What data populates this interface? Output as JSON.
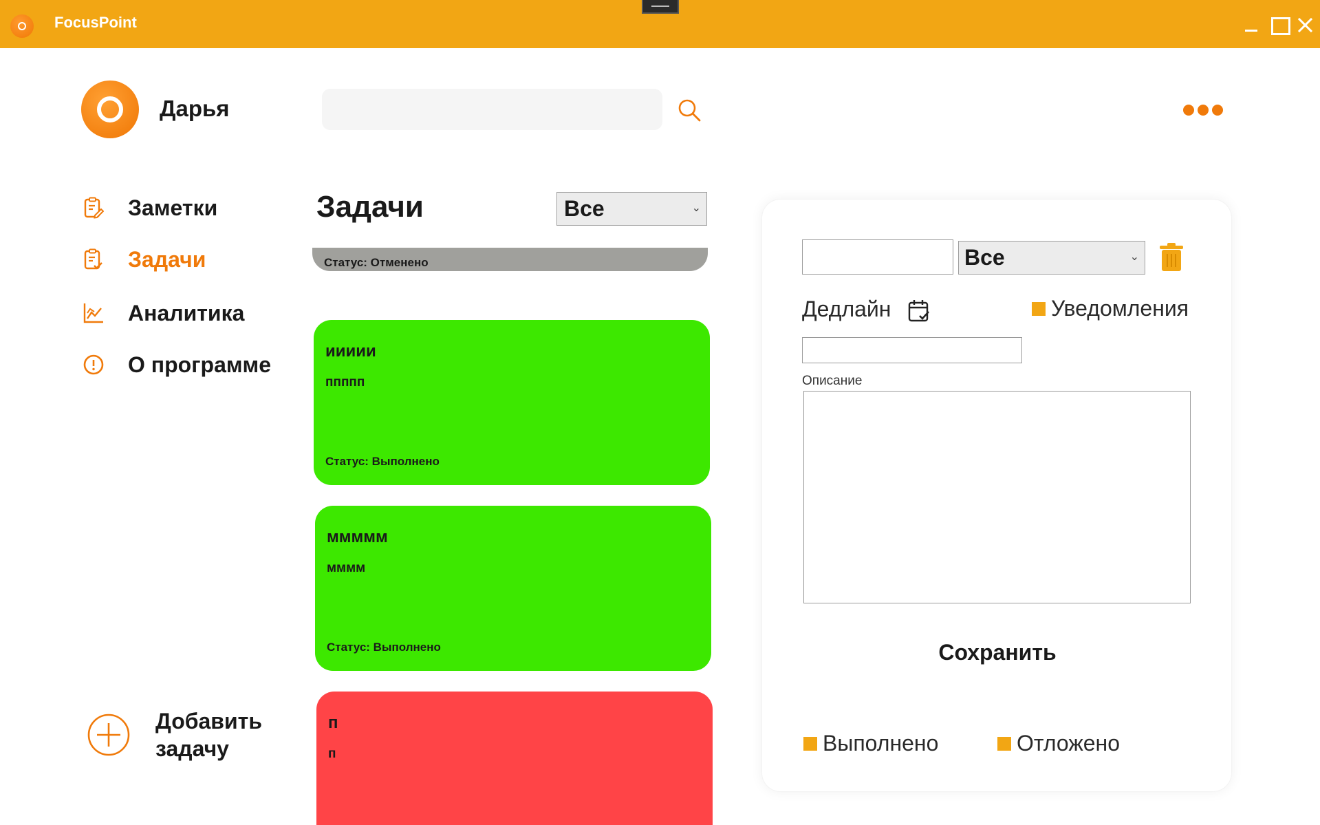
{
  "window": {
    "title": "FocusPoint"
  },
  "header": {
    "username": "Дарья",
    "search": {
      "value": "",
      "placeholder": ""
    }
  },
  "sidebar": {
    "items": [
      {
        "label": "Заметки",
        "icon": "notes-icon",
        "active": false
      },
      {
        "label": "Задачи",
        "icon": "tasks-icon",
        "active": true
      },
      {
        "label": "Аналитика",
        "icon": "analytics-icon",
        "active": false
      },
      {
        "label": "О программе",
        "icon": "info-icon",
        "active": false
      }
    ],
    "add_task_label": "Добавить задачу"
  },
  "tasks": {
    "title": "Задачи",
    "filter_value": "Все",
    "items": [
      {
        "title": "",
        "description": "",
        "status": "Статус: Отменено",
        "color": "#a0a09c"
      },
      {
        "title": "иииии",
        "description": "ппппп",
        "status": "Статус: Выполнено",
        "color": "#3de800"
      },
      {
        "title": "ммммм",
        "description": "мммм",
        "status": "Статус: Выполнено",
        "color": "#3de800"
      },
      {
        "title": "п",
        "description": "п",
        "status": "",
        "color": "#ff4447"
      }
    ]
  },
  "editor": {
    "title_value": "",
    "status_value": "Все",
    "deadline_label": "Дедлайн",
    "deadline_value": "",
    "notifications_label": "Уведомления",
    "description_label": "Описание",
    "description_value": "",
    "save_label": "Сохранить",
    "done_label": "Выполнено",
    "postponed_label": "Отложено"
  },
  "colors": {
    "accent": "#f07a0a",
    "titlebar": "#f2a614",
    "checkbox": "#f2a614",
    "done": "#3de800",
    "cancelled": "#a0a09c",
    "overdue": "#ff4447"
  }
}
